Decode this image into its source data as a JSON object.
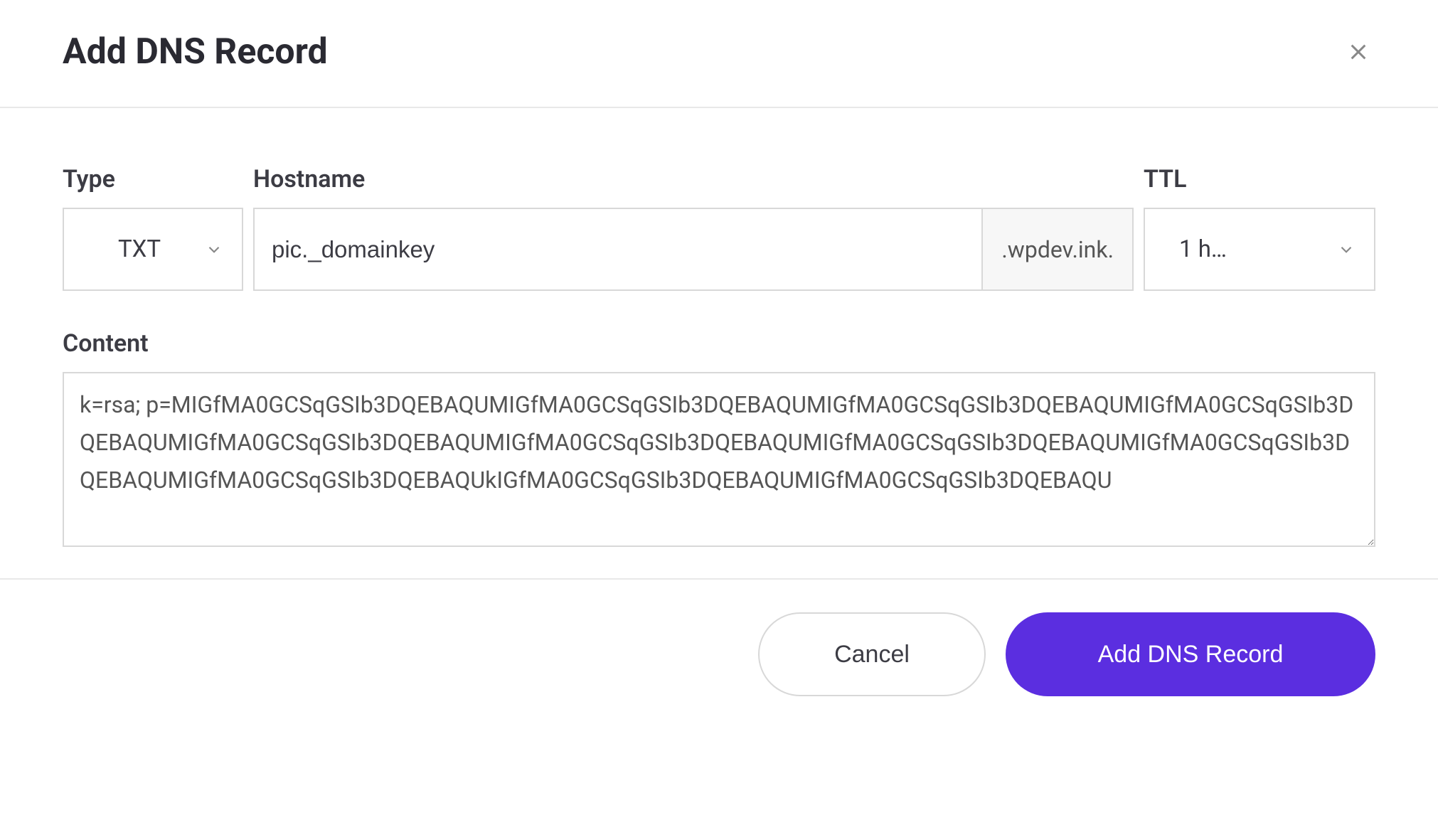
{
  "modal": {
    "title": "Add DNS Record"
  },
  "fields": {
    "type": {
      "label": "Type",
      "value": "TXT"
    },
    "hostname": {
      "label": "Hostname",
      "value": "pic._domainkey",
      "suffix": ".wpdev.ink."
    },
    "ttl": {
      "label": "TTL",
      "value": "1 h…"
    },
    "content": {
      "label": "Content",
      "value": "k=rsa; p=MIGfMA0GCSqGSIb3DQEBAQUMIGfMA0GCSqGSIb3DQEBAQUMIGfMA0GCSqGSIb3DQEBAQUMIGfMA0GCSqGSIb3DQEBAQUMIGfMA0GCSqGSIb3DQEBAQUMIGfMA0GCSqGSIb3DQEBAQUMIGfMA0GCSqGSIb3DQEBAQUMIGfMA0GCSqGSIb3DQEBAQUMIGfMA0GCSqGSIb3DQEBAQUkIGfMA0GCSqGSIb3DQEBAQUMIGfMA0GCSqGSIb3DQEBAQU"
    }
  },
  "buttons": {
    "cancel": "Cancel",
    "submit": "Add DNS Record"
  }
}
